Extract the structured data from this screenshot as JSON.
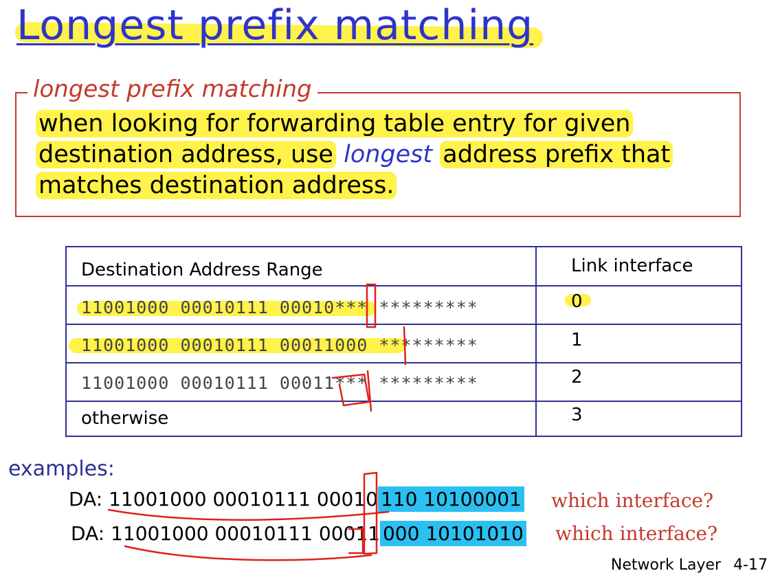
{
  "title": "Longest prefix matching",
  "definition": {
    "heading": "longest prefix matching",
    "line1": "when looking for forwarding table entry for given",
    "line2_before": "destination address, use",
    "line2_italic": "longest",
    "line2_after": "address prefix that",
    "line3": "matches destination address."
  },
  "table": {
    "header_range": "Destination Address Range",
    "header_interface": "Link interface",
    "rows": [
      {
        "range": "11001000 00010111 00010*** *********",
        "interface": "0"
      },
      {
        "range": "11001000 00010111 00011000 *********",
        "interface": "1"
      },
      {
        "range": "11001000 00010111 00011*** *********",
        "interface": "2"
      },
      {
        "range": "otherwise",
        "interface": "3"
      }
    ]
  },
  "examples": {
    "label": "examples:",
    "items": [
      {
        "prefix": "DA: 11001000  00010111  00010",
        "highlighted": "110  10100001",
        "question": "which interface?"
      },
      {
        "prefix": "DA: 11001000  00010111  00011",
        "highlighted": "000  10101010",
        "question": "which interface?"
      }
    ]
  },
  "footer": {
    "section": "Network Layer",
    "page": "4-17"
  },
  "colors": {
    "title_blue": "#2e34c8",
    "box_red": "#c33a2c",
    "table_navy": "#2e3192",
    "highlight_yellow": "#fff24a",
    "highlight_cyan": "#2cc0f2"
  }
}
